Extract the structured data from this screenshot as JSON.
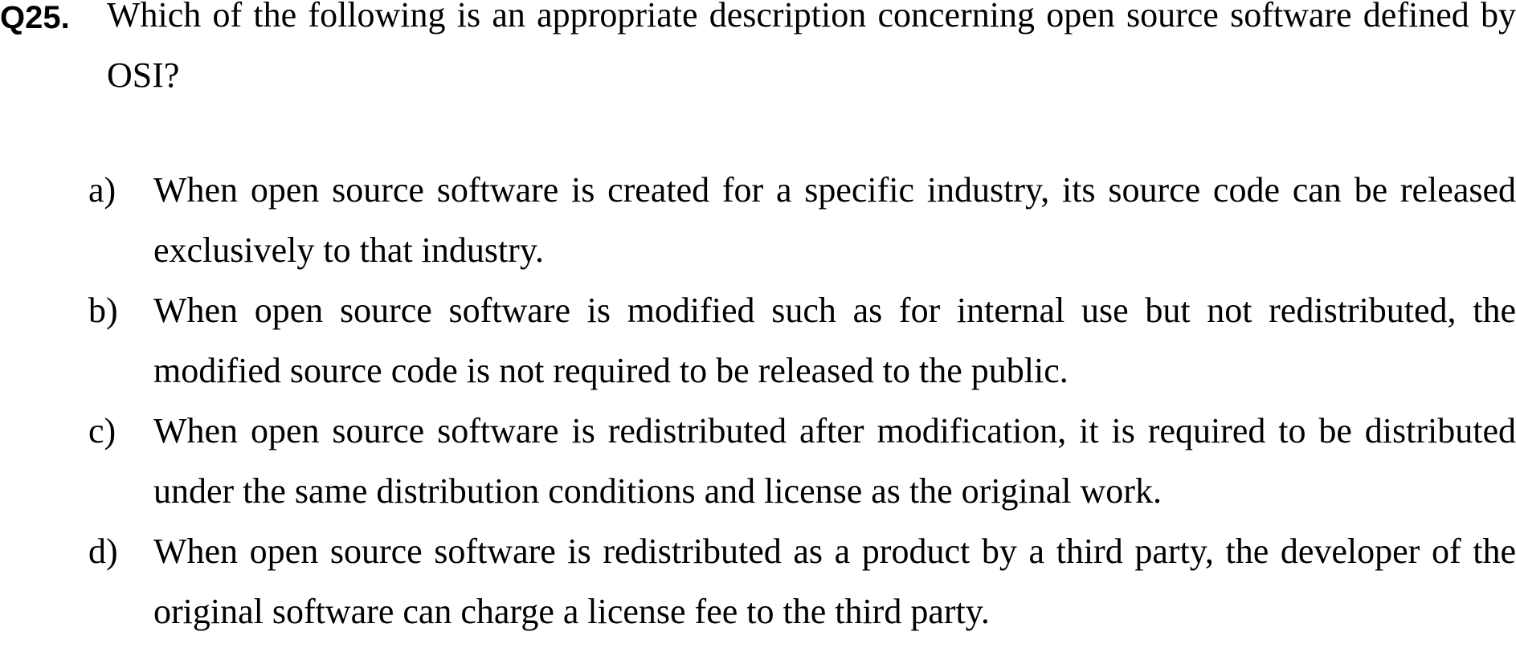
{
  "question": {
    "number": "Q25.",
    "text": "Which of the following is an appropriate description concerning open source software defined by OSI?"
  },
  "options": [
    {
      "letter": "a)",
      "text": "When open source software is created for a specific industry, its source code can be released exclusively to that industry."
    },
    {
      "letter": "b)",
      "text": "When open source software is modified such as for internal use but not redistributed, the modified source code is not required to be released to the public."
    },
    {
      "letter": "c)",
      "text": "When open source software is redistributed after modification, it is required to be distributed under the same distribution conditions and license as the original work."
    },
    {
      "letter": "d)",
      "text": "When open source software is redistributed as a product by a third party, the developer of the original software can charge a license fee to the third party."
    }
  ]
}
